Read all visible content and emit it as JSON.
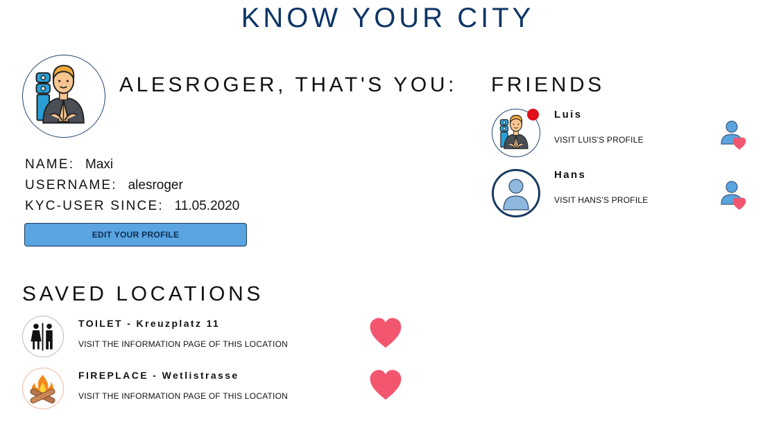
{
  "app": {
    "title": "KNOW YOUR CITY"
  },
  "profile": {
    "heading": "ALESROGER, THAT'S YOU:",
    "fields": [
      {
        "label": "NAME:",
        "value": "Maxi"
      },
      {
        "label": "USERNAME:",
        "value": "alesroger"
      },
      {
        "label": "KYC-USER SINCE:",
        "value": "11.05.2020"
      }
    ],
    "edit_button": "EDIT YOUR PROFILE"
  },
  "friends": {
    "title": "FRIENDS",
    "items": [
      {
        "name": "Luis",
        "link": "VISIT LUIS'S PROFILE",
        "online": true
      },
      {
        "name": "Hans",
        "link": "VISIT HANS'S PROFILE",
        "online": false
      }
    ]
  },
  "saved": {
    "title": "SAVED LOCATIONS",
    "items": [
      {
        "title": "TOILET - Kreuzplatz 11",
        "link": "VISIT THE INFORMATION PAGE OF THIS LOCATION",
        "icon": "toilet-icon"
      },
      {
        "title": "FIREPLACE - Wetlistrasse",
        "link": "VISIT THE INFORMATION PAGE OF THIS LOCATION",
        "icon": "fireplace-icon"
      }
    ]
  },
  "colors": {
    "title": "#0c3566",
    "button": "#5aa4e0",
    "heart": "#f2566f",
    "online_dot": "#e0101c",
    "avatar_border": "#1d4470"
  }
}
